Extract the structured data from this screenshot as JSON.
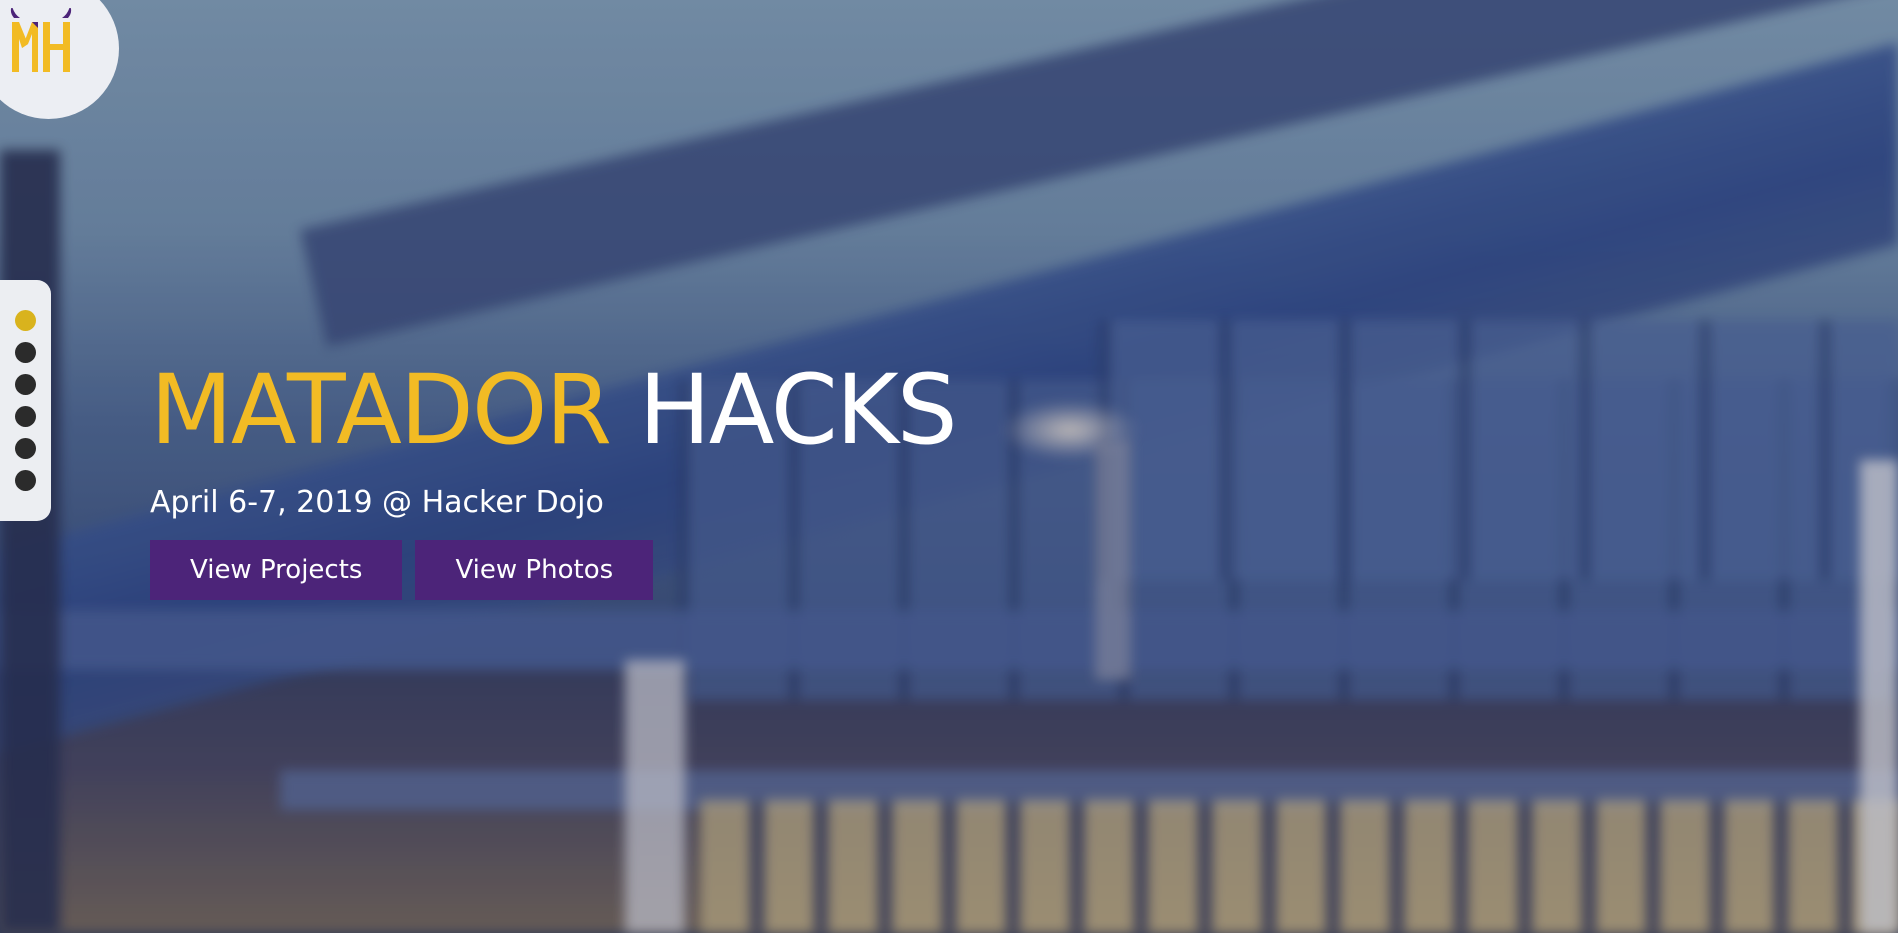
{
  "logo": {
    "text": "MH",
    "colors": {
      "m": "#f2bb24",
      "h": "#f2bb24",
      "horns": "#4c2479",
      "background": "#eceef3"
    }
  },
  "sidenav": {
    "dots": [
      {
        "section": "1",
        "active": true
      },
      {
        "section": "2",
        "active": false
      },
      {
        "section": "3",
        "active": false
      },
      {
        "section": "4",
        "active": false
      },
      {
        "section": "5",
        "active": false
      },
      {
        "section": "6",
        "active": false
      }
    ],
    "active_color": "#d9b31d",
    "inactive_color": "#2b2b2b"
  },
  "hero": {
    "title_part1": "MATADOR",
    "title_part2": "HACKS",
    "subtitle": "April 6-7, 2019 @ Hacker Dojo",
    "buttons": {
      "projects": "View Projects",
      "photos": "View Photos"
    },
    "colors": {
      "accent": "#f2bb24",
      "button_bg": "#4c2479",
      "text": "#ffffff"
    }
  }
}
